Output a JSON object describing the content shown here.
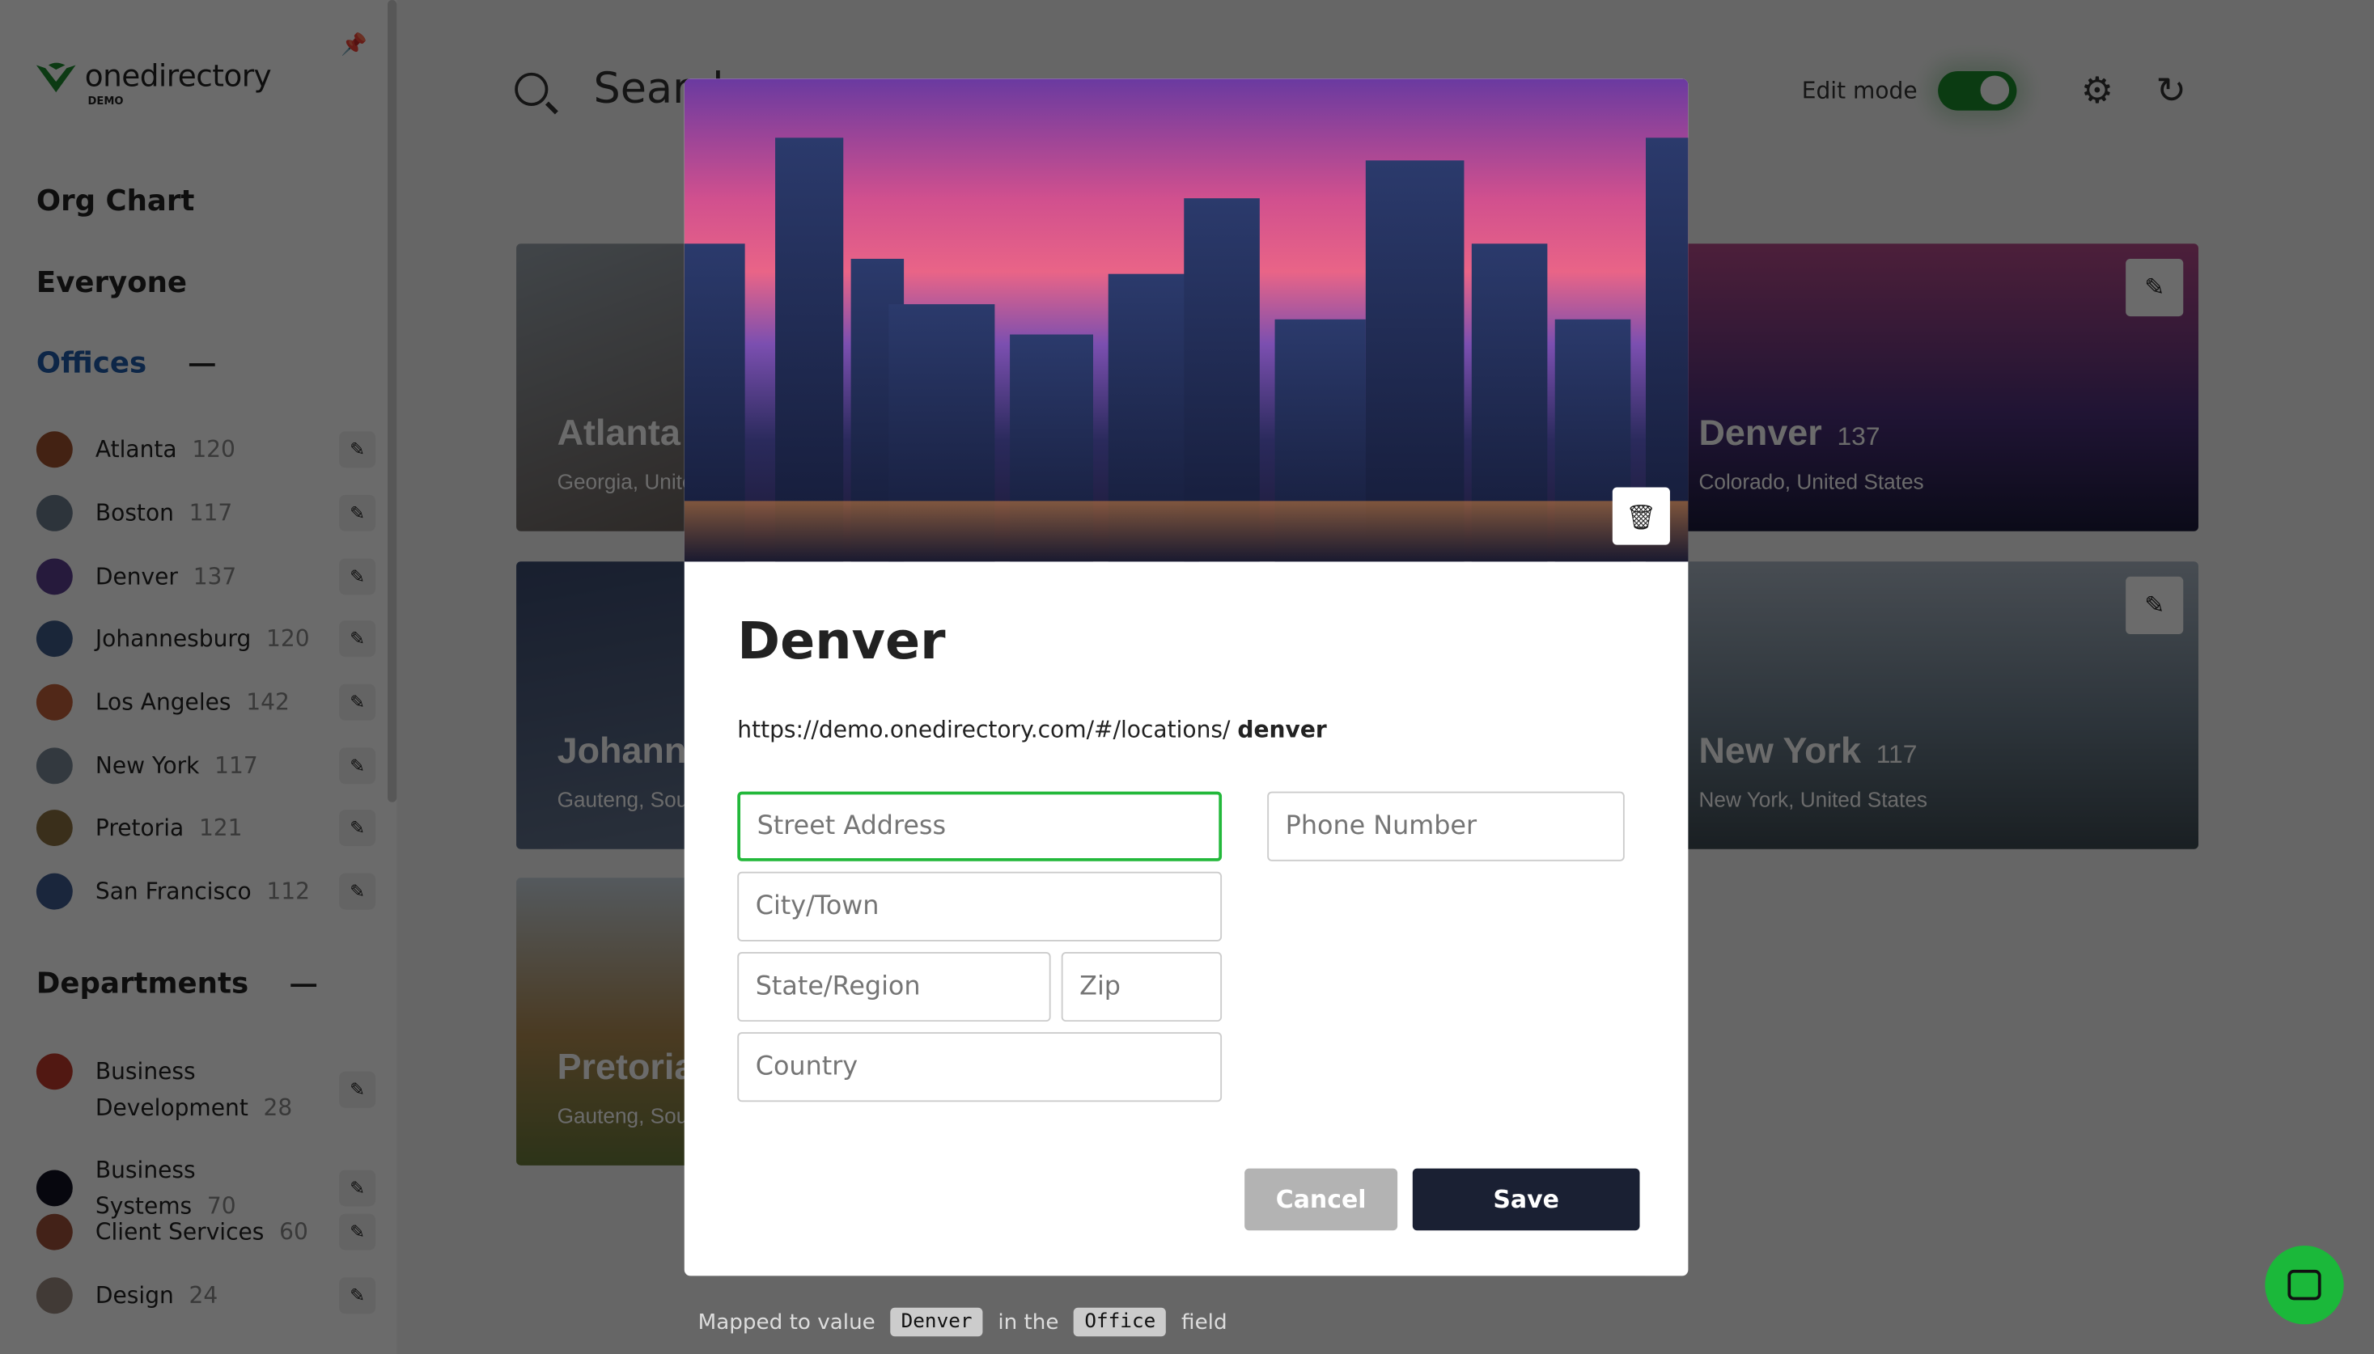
{
  "app": {
    "brand": "onedirectory",
    "brand_sub": "DEMO"
  },
  "sidebar": {
    "nav": [
      "Org Chart",
      "Everyone"
    ],
    "offices_label": "Offices",
    "offices": [
      {
        "name": "Atlanta",
        "count": "120",
        "color": "#a0522d"
      },
      {
        "name": "Boston",
        "count": "117",
        "color": "#6b7b8c"
      },
      {
        "name": "Denver",
        "count": "137",
        "color": "#5b3d8f"
      },
      {
        "name": "Johannesburg",
        "count": "120",
        "color": "#3e5a88"
      },
      {
        "name": "Los Angeles",
        "count": "142",
        "color": "#c0603a"
      },
      {
        "name": "New York",
        "count": "117",
        "color": "#7a8896"
      },
      {
        "name": "Pretoria",
        "count": "121",
        "color": "#8a7040"
      },
      {
        "name": "San Francisco",
        "count": "112",
        "color": "#3d5a8f"
      }
    ],
    "departments_label": "Departments",
    "departments": [
      {
        "name": "Business Development",
        "count": "28",
        "color": "#c0392b"
      },
      {
        "name": "Business Systems",
        "count": "70",
        "color": "#111122"
      },
      {
        "name": "Client Services",
        "count": "60",
        "color": "#a0523a"
      },
      {
        "name": "Design",
        "count": "24",
        "color": "#9a8a80"
      }
    ]
  },
  "header": {
    "search_placeholder": "Search",
    "edit_mode_label": "Edit mode",
    "edit_mode_on": true
  },
  "cards": [
    {
      "name": "Atlanta",
      "sub": "Georgia, United States"
    },
    {
      "name": "Denver",
      "count": "137",
      "sub": "Colorado, United States"
    },
    {
      "name": "Johannesburg",
      "sub": "Gauteng, South Africa"
    },
    {
      "name": "New York",
      "count": "117",
      "sub": "New York, United States"
    },
    {
      "name": "Pretoria",
      "sub": "Gauteng, South Africa"
    }
  ],
  "modal": {
    "title": "Denver",
    "url_prefix": "https://demo.onedirectory.com/#/locations/",
    "url_slug": "denver",
    "fields": {
      "street": "Street Address",
      "phone": "Phone Number",
      "city": "City/Town",
      "state": "State/Region",
      "zip": "Zip",
      "country": "Country"
    },
    "cancel": "Cancel",
    "save": "Save"
  },
  "hint": {
    "prefix": "Mapped to value",
    "value": "Denver",
    "middle": "in the",
    "field": "Office",
    "suffix": "field"
  },
  "colors": {
    "accent": "#1e5aa8",
    "green": "#1bb83a",
    "save": "#1a2033",
    "cancel": "#b3b3b3"
  }
}
